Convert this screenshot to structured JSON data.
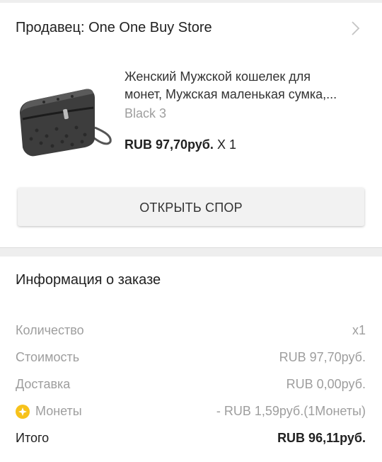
{
  "seller": {
    "label": "Продавец: One One Buy Store"
  },
  "product": {
    "title_line1": "Женский Мужской кошелек для",
    "title_line2": "монет, Мужская маленькая сумка,...",
    "variant": "Black 3",
    "price": "RUB 97,70руб.",
    "quantity": "X 1"
  },
  "dispute_button": "ОТКРЫТЬ СПОР",
  "order_info": {
    "title": "Информация о заказе",
    "rows": [
      {
        "label": "Количество",
        "value": "x1"
      },
      {
        "label": "Стоимость",
        "value": "RUB 97,70руб."
      },
      {
        "label": "Доставка",
        "value": "RUB 0,00руб."
      },
      {
        "label": "Монеты",
        "value": "- RUB 1,59руб.(1Монеты)",
        "icon": "coin-icon"
      },
      {
        "label": "Итого",
        "value": "RUB 96,11руб."
      }
    ]
  },
  "colors": {
    "coin": "#f7c21b",
    "muted": "#9e9e9e",
    "text": "#212121"
  }
}
